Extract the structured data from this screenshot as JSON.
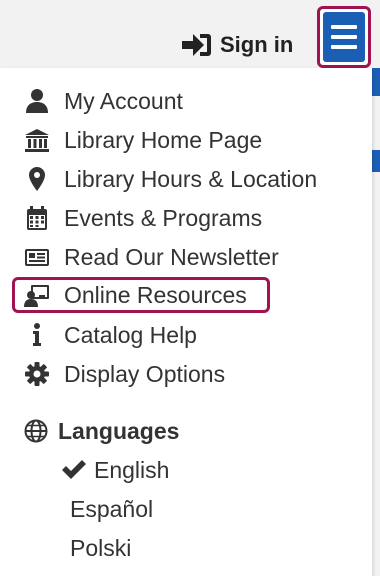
{
  "header": {
    "sign_in_label": "Sign in",
    "sign_in_icon": "sign-in-icon",
    "menu_icon": "hamburger-menu-icon",
    "accent_color": "#1a5fb4",
    "highlight_color": "#a0134f"
  },
  "menu": {
    "items": [
      {
        "label": "My Account",
        "icon": "user-icon"
      },
      {
        "label": "Library Home Page",
        "icon": "library-building-icon"
      },
      {
        "label": "Library Hours & Location",
        "icon": "map-pin-icon"
      },
      {
        "label": "Events & Programs",
        "icon": "calendar-icon"
      },
      {
        "label": "Read Our Newsletter",
        "icon": "newspaper-icon"
      },
      {
        "label": "Online Resources",
        "icon": "online-resources-icon"
      },
      {
        "label": "Catalog Help",
        "icon": "info-icon"
      },
      {
        "label": "Display Options",
        "icon": "gear-icon"
      }
    ]
  },
  "languages": {
    "title": "Languages",
    "title_icon": "globe-icon",
    "selected": "English",
    "options": [
      "English",
      "Español",
      "Polski"
    ]
  }
}
